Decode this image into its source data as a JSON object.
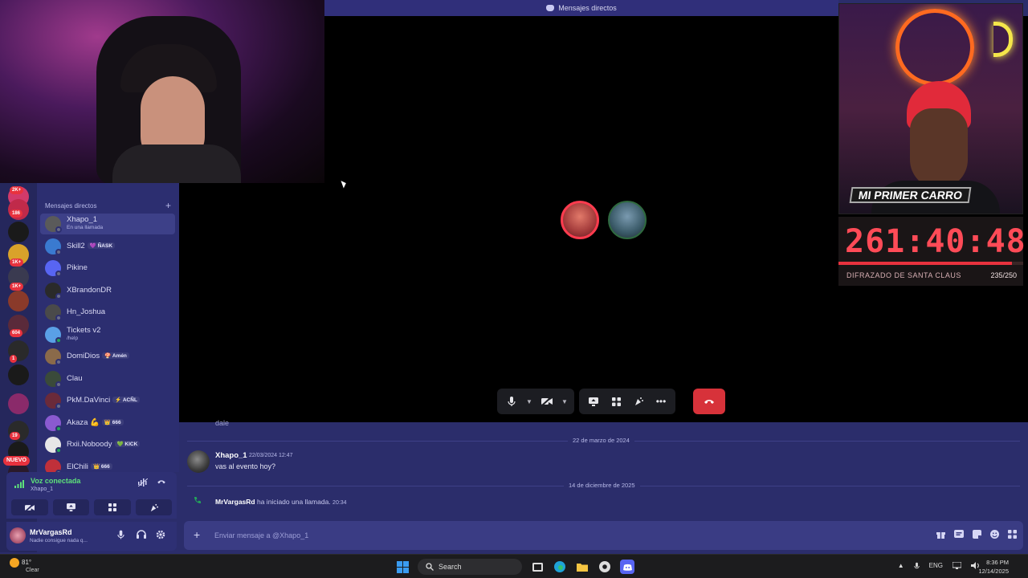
{
  "window": {
    "title": "Mensajes directos"
  },
  "stream_overlay": {
    "banner_text": "MI PRIMER CARRO",
    "timer": "261:40:48",
    "goal_label": "DIFRAZADO DE SANTA CLAUS",
    "goal_count": "235/250",
    "goal_progress": 0.94
  },
  "servers": {
    "badges": [
      "2K+",
      "186",
      "1K+",
      "1K+",
      "604",
      "1",
      "19"
    ],
    "new_label": "NUEVO"
  },
  "dm_list": {
    "header": "Mensajes directos",
    "add_icon": "plus-icon",
    "items": [
      {
        "name": "Xhapo_1",
        "sub": "En una llamada",
        "active": true,
        "online": false,
        "color": "#5a5a5a"
      },
      {
        "name": "Skill2",
        "tag": "💜 ÑASK",
        "online": false,
        "color": "#3a7ad0"
      },
      {
        "name": "Pikine",
        "online": false,
        "color": "#5865f2"
      },
      {
        "name": "XBrandonDR",
        "online": false,
        "color": "#2a2a2a"
      },
      {
        "name": "Hn_Joshua",
        "online": false,
        "color": "#4a4a4a"
      },
      {
        "name": "Tickets v2",
        "sub": "/help",
        "online": true,
        "color": "#5aa0e6"
      },
      {
        "name": "DomiDios",
        "tag": "🍄 Amén",
        "online": false,
        "color": "#8a6a4a"
      },
      {
        "name": "Clau",
        "online": false,
        "color": "#3a4a3a"
      },
      {
        "name": "PkM.DaVinci",
        "tag": "⚡ ACÑL",
        "online": false,
        "color": "#6a2a3a"
      },
      {
        "name": "Akaza 💪",
        "tag": "👑 666",
        "online": true,
        "color": "#8a5ad0"
      },
      {
        "name": "Rxii.Noboody",
        "tag": "💚 KICK",
        "online": true,
        "color": "#e6e6e6"
      },
      {
        "name": "ElChili",
        "tag": "👑 666",
        "online": false,
        "color": "#c0303a"
      }
    ]
  },
  "voice": {
    "status": "Voz conectada",
    "channel": "Xhapo_1"
  },
  "user": {
    "name": "MrVargasRd",
    "status": "Nadie consigue nada q..."
  },
  "chat": {
    "clipped_text": "dale",
    "divider_1": "22 de marzo de 2024",
    "message": {
      "author": "Xhapo_1",
      "time": "22/03/2024 12:47",
      "text": "vas al evento hoy?"
    },
    "divider_2": "14 de diciembre de 2025",
    "system": {
      "author": "MrVargasRd",
      "text": "ha iniciado una llamada.",
      "time": "20:34"
    },
    "composer_placeholder": "Enviar mensaje a @Xhapo_1"
  },
  "taskbar": {
    "weather_temp": "81°",
    "weather_desc": "Clear",
    "search_label": "Search",
    "lang": "ENG",
    "time": "8:36 PM",
    "date": "12/14/2025"
  }
}
